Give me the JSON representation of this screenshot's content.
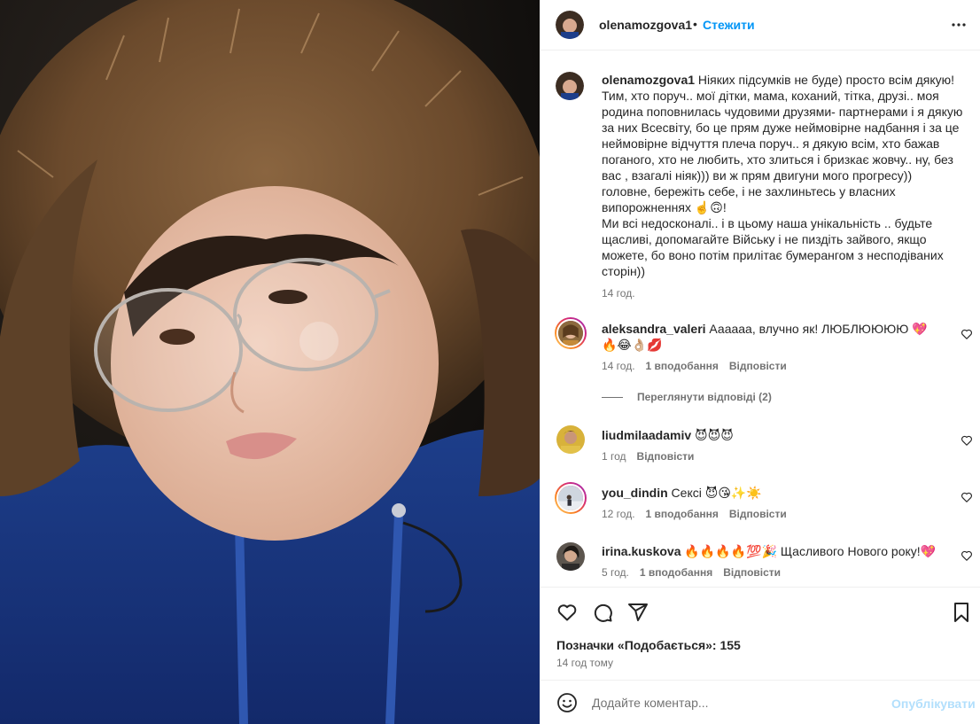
{
  "post": {
    "author": "olenamozgova1",
    "separator": "•",
    "follow_label": "Стежити",
    "more_icon": "more-horizontal-icon"
  },
  "caption": {
    "username": "olenamozgova1",
    "text": " Ніяких підсумків не буде) просто всім дякую! Тим, хто поруч.. мої дітки, мама, коханий, тітка, друзі.. моя родина поповнилась чудовими друзями- партнерами і я дякую за них Всесвіту, бо це прям дуже неймовірне надбання і за це неймовірне відчуття плеча поруч.. я дякую всім, хто бажав поганого, хто не любить, хто злиться і бризкає жовчу.. ну, без вас , взагалі ніяк))) ви ж прям двигуни мого прогресу)) головне, бережіть себе, і не захлиньтесь у власних випорожненнях ☝️🙃!\nМи всі недосконалі.. і в цьому наша унікальність .. будьте щасливі, допомагайте Війську і не пиздіть зайвого, якщо можете, бо воно потім прилітає бумерангом з несподіваних сторін))",
    "time": "14 год."
  },
  "comments": [
    {
      "username": "aleksandra_valeri",
      "text": " Аааааа, влучно як! ЛЮБЛЮЮЮЮ 💖🔥😂👌🏼💋",
      "time": "14 год.",
      "likes": "1 вподобання",
      "reply": "Відповісти"
    },
    {
      "username": "liudmilaadamiv",
      "text": " 😈😈😈",
      "time": "1 год",
      "likes": "",
      "reply": "Відповісти"
    },
    {
      "username": "you_dindin",
      "text": " Сексі 😈😘✨☀️",
      "time": "12 год.",
      "likes": "1 вподобання",
      "reply": "Відповісти"
    },
    {
      "username": "irina.kuskova",
      "text": " 🔥🔥🔥🔥💯🎉 Щасливого Нового року!💖",
      "time": "5 год.",
      "likes": "1 вподобання",
      "reply": "Відповісти"
    }
  ],
  "view_replies": "Переглянути відповіді (2)",
  "actions": {
    "likes_text": "Позначки «Подобається»: 155",
    "time_ago": "14 год тому",
    "icons": [
      "heart-icon",
      "comment-icon",
      "share-icon",
      "bookmark-icon"
    ]
  },
  "composer": {
    "placeholder": "Додайте коментар...",
    "post_label": "Опублікувати"
  },
  "colors": {
    "accent": "#0095f6",
    "muted": "#737373",
    "text": "#262626",
    "post_disabled": "#b2dffc"
  }
}
